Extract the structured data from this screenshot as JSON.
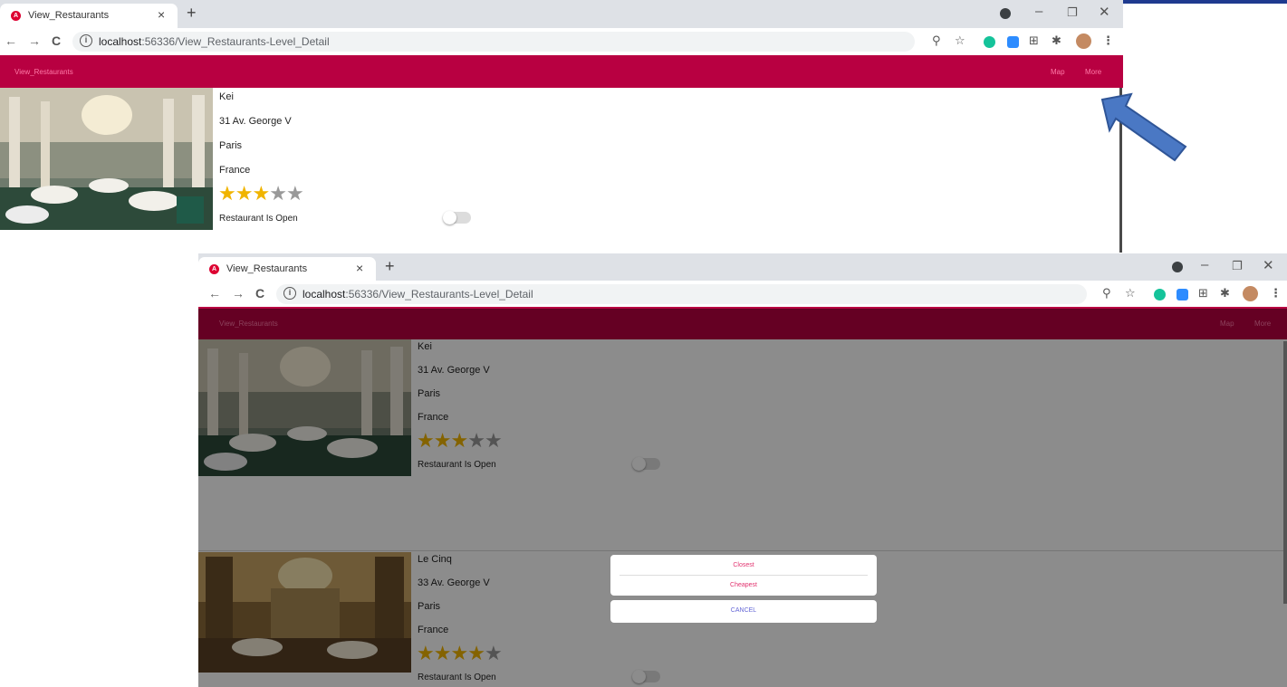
{
  "browser": {
    "tab_title": "View_Restaurants",
    "tab_close": "×",
    "new_tab": "+",
    "url_host": "localhost",
    "url_path": ":56336/View_Restaurants-Level_Detail",
    "nav_back": "←",
    "nav_forward": "→",
    "nav_reload": "C",
    "zoom_icon": "⚲",
    "bookmark_icon": "☆",
    "menu_icon": "⋮",
    "puzzle_icon": "✱",
    "grid_icon": "⊞",
    "min": "–",
    "max": "❐",
    "close": "✕",
    "info": "i"
  },
  "app": {
    "title": "View_Restaurants",
    "menu_map": "Map",
    "menu_more": "More"
  },
  "restaurants": [
    {
      "name": "Kei",
      "address": "31 Av. George V",
      "city": "Paris",
      "country": "France",
      "rating": 3,
      "open_label": "Restaurant Is Open",
      "is_open": false
    },
    {
      "name": "Le Cinq",
      "address": "33 Av. George V",
      "city": "Paris",
      "country": "France",
      "rating": 4,
      "open_label": "Restaurant Is Open",
      "is_open": false
    }
  ],
  "action_sheet": {
    "option_1": "Closest",
    "option_2": "Cheapest",
    "cancel": "CANCEL"
  },
  "colors": {
    "app_bar": "#b80041",
    "star_on": "#f0b400",
    "star_off": "#999999",
    "arrow": "#4a78c4"
  }
}
